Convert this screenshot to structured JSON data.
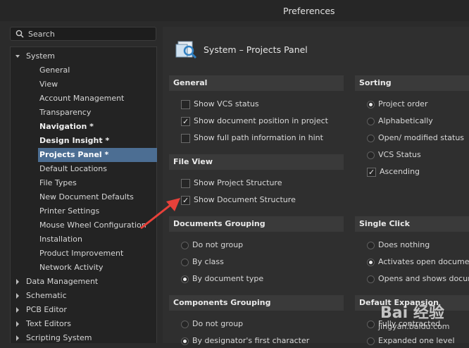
{
  "window": {
    "title": "Preferences"
  },
  "search": {
    "label": "Search"
  },
  "tree": {
    "items": [
      {
        "label": "System",
        "level": 0,
        "expanded": true
      },
      {
        "label": "General",
        "level": 1
      },
      {
        "label": "View",
        "level": 1
      },
      {
        "label": "Account Management",
        "level": 1
      },
      {
        "label": "Transparency",
        "level": 1
      },
      {
        "label": "Navigation *",
        "level": 1,
        "bold": true
      },
      {
        "label": "Design Insight *",
        "level": 1,
        "bold": true
      },
      {
        "label": "Projects Panel *",
        "level": 1,
        "bold": true,
        "selected": true
      },
      {
        "label": "Default Locations",
        "level": 1
      },
      {
        "label": "File Types",
        "level": 1
      },
      {
        "label": "New Document Defaults",
        "level": 1
      },
      {
        "label": "Printer Settings",
        "level": 1
      },
      {
        "label": "Mouse Wheel Configuration",
        "level": 1
      },
      {
        "label": "Installation",
        "level": 1
      },
      {
        "label": "Product Improvement",
        "level": 1
      },
      {
        "label": "Network Activity",
        "level": 1
      },
      {
        "label": "Data Management",
        "level": 0
      },
      {
        "label": "Schematic",
        "level": 0
      },
      {
        "label": "PCB Editor",
        "level": 0
      },
      {
        "label": "Text Editors",
        "level": 0
      },
      {
        "label": "Scripting System",
        "level": 0
      }
    ]
  },
  "page": {
    "title": "System – Projects Panel",
    "icon": "projects-panel-icon"
  },
  "sections": {
    "general": {
      "title": "General",
      "options": [
        {
          "label": "Show VCS status",
          "checked": false
        },
        {
          "label": "Show document position in project",
          "checked": true
        },
        {
          "label": "Show full path information in hint",
          "checked": false
        }
      ]
    },
    "file_view": {
      "title": "File View",
      "options": [
        {
          "label": "Show Project Structure",
          "checked": false
        },
        {
          "label": "Show Document Structure",
          "checked": true
        }
      ]
    },
    "documents_grouping": {
      "title": "Documents Grouping",
      "options": [
        {
          "label": "Do not group",
          "selected": false
        },
        {
          "label": "By class",
          "selected": false
        },
        {
          "label": "By document type",
          "selected": true
        }
      ]
    },
    "components_grouping": {
      "title": "Components Grouping",
      "options": [
        {
          "label": "Do not group",
          "selected": false
        },
        {
          "label": "By designator's first character",
          "selected": true
        }
      ]
    },
    "sorting": {
      "title": "Sorting",
      "options": [
        {
          "label": "Project order",
          "selected": true
        },
        {
          "label": "Alphabetically",
          "selected": false
        },
        {
          "label": "Open/ modified status",
          "selected": false
        },
        {
          "label": "VCS Status",
          "selected": false
        }
      ],
      "ascending": {
        "label": "Ascending",
        "checked": true
      }
    },
    "single_click": {
      "title": "Single Click",
      "options": [
        {
          "label": "Does nothing",
          "selected": false
        },
        {
          "label": "Activates open documen",
          "selected": true
        },
        {
          "label": "Opens and shows docum",
          "selected": false
        }
      ]
    },
    "default_expansion": {
      "title": "Default Expansion",
      "options": [
        {
          "label": "Fully contracted",
          "selected": false
        },
        {
          "label": "Expanded one level",
          "selected": false
        }
      ]
    }
  },
  "watermark": {
    "text": "Bai 经验",
    "sub": "jingyan.baidu.com"
  },
  "colors": {
    "selection": "#4c6e93",
    "arrow": "#e8413a"
  }
}
